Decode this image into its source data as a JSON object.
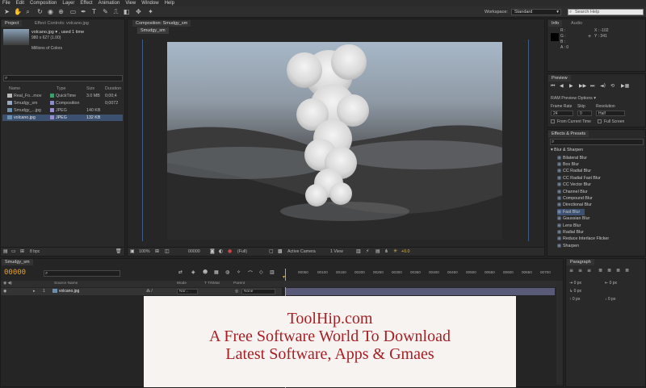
{
  "menu": [
    "File",
    "Edit",
    "Composition",
    "Layer",
    "Effect",
    "Animation",
    "View",
    "Window",
    "Help"
  ],
  "toolbar": {
    "workspace_label": "Workspace:",
    "workspace_value": "Standard",
    "search_placeholder": "Search Help"
  },
  "project": {
    "tab_project": "Project",
    "tab_effect_controls": "Effect Controls: volcano.jpg",
    "file_name": "volcano.jpg ▾ , used 1 time",
    "dimensions": "980 x 627 (1.00)",
    "colors": "Millions of Colors",
    "columns": [
      "Name",
      "Type",
      "Size",
      "Duration"
    ],
    "items": [
      {
        "name": "Real_Fo...mov",
        "type": "QuickTime",
        "size": "3.0 MB",
        "duration": "0;00;4",
        "swatch": "#3e9e6e"
      },
      {
        "name": "Smudgy_sm",
        "type": "Composition",
        "size": "",
        "duration": "0;0072",
        "swatch": "#8a8fc9"
      },
      {
        "name": "Smudgy_...jpg",
        "type": "JPEG",
        "size": "140 KB",
        "duration": "",
        "swatch": "#9a8fcf"
      },
      {
        "name": "volcano.jpg",
        "type": "JPEG",
        "size": "132 KB",
        "duration": "",
        "swatch": "#9a8fcf"
      }
    ],
    "bpc": "8 bpc"
  },
  "composition": {
    "tab": "Composition: Smudgy_sm",
    "subtab": "Smudgy_sm",
    "zoom": "100%",
    "timecode": "00000",
    "quality": "(Full)",
    "camera": "Active Camera",
    "view": "1 View",
    "exposure": "+0.0"
  },
  "info": {
    "tab_info": "Info",
    "tab_audio": "Audio",
    "r": "R :",
    "g": "G :",
    "b": "B :",
    "a": "A : 0",
    "x": "X : -102",
    "y": "Y : 341"
  },
  "preview": {
    "tab": "Preview",
    "ram_options": "RAM Preview Options",
    "frame_rate_label": "Frame Rate",
    "frame_rate": "24",
    "skip_label": "Skip",
    "skip": "0",
    "resolution_label": "Resolution",
    "resolution": "Half",
    "from_current": "From Current Time",
    "full_screen": "Full Screen"
  },
  "effects": {
    "tab": "Effects & Presets",
    "category": "▾ Blur & Sharpen",
    "items": [
      "Bilateral Blur",
      "Box Blur",
      "CC Radial Blur",
      "CC Radial Fast Blur",
      "CC Vector Blur",
      "Channel Blur",
      "Compound Blur",
      "Directional Blur",
      "Fast Blur",
      "Gaussian Blur",
      "Lens Blur",
      "Radial Blur",
      "Reduce Interlace Flicker",
      "Sharpen"
    ],
    "selected": "Fast Blur"
  },
  "timeline": {
    "tab": "Smudgy_sm",
    "timecode": "00000",
    "columns": {
      "source": "Source Name",
      "mode": "Mode",
      "trkmat": "T TrkMat",
      "parent": "Parent"
    },
    "layer": {
      "num": "1",
      "name": "volcano.jpg",
      "mode": "Nor...",
      "parent": "None"
    },
    "ticks": [
      "00050",
      "00100",
      "00150",
      "00200",
      "00250",
      "00300",
      "00350",
      "00400",
      "00450",
      "00500",
      "00550",
      "00600",
      "00650",
      "00700"
    ]
  },
  "paragraph": {
    "tab": "Paragraph",
    "values": [
      "0 px",
      "0 px",
      "0 px",
      "0 px",
      "0 px"
    ]
  },
  "banner": {
    "line1": "ToolHip.com",
    "line2": "A Free Software World To Download",
    "line3": "Latest Software, Apps & Gmaes"
  }
}
